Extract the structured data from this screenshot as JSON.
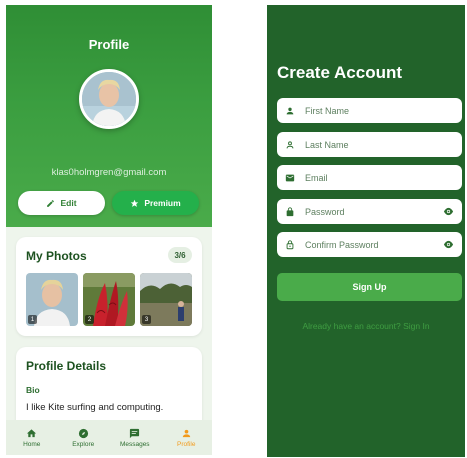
{
  "profile_screen": {
    "title": "Profile",
    "email": "klas0holmgren@gmail.com",
    "buttons": {
      "edit": "Edit",
      "premium": "Premium"
    },
    "photos": {
      "title": "My Photos",
      "count": "3/6",
      "items": [
        {
          "number": "1"
        },
        {
          "number": "2"
        },
        {
          "number": "3"
        }
      ]
    },
    "details": {
      "title": "Profile Details",
      "bio_label": "Bio",
      "bio_text": "I like Kite surfing and computing."
    },
    "nav": [
      {
        "label": "Home",
        "icon": "home-icon",
        "active": false
      },
      {
        "label": "Explore",
        "icon": "compass-icon",
        "active": false
      },
      {
        "label": "Messages",
        "icon": "message-icon",
        "active": false
      },
      {
        "label": "Profile",
        "icon": "person-icon",
        "active": true
      }
    ],
    "colors": {
      "primary": "#2f8e35",
      "premium": "#24b04b",
      "active_nav": "#f29a1b"
    }
  },
  "signup_screen": {
    "title": "Create Account",
    "fields": [
      {
        "placeholder": "First Name",
        "icon": "person-icon"
      },
      {
        "placeholder": "Last Name",
        "icon": "person-outline-icon"
      },
      {
        "placeholder": "Email",
        "icon": "email-icon"
      },
      {
        "placeholder": "Password",
        "icon": "lock-icon",
        "toggle": "eye-icon"
      },
      {
        "placeholder": "Confirm Password",
        "icon": "lock-outline-icon",
        "toggle": "eye-icon"
      }
    ],
    "submit_label": "Sign Up",
    "signin_link": "Already have an account? Sign In",
    "colors": {
      "background": "#22632a",
      "button": "#4aab4a"
    }
  }
}
